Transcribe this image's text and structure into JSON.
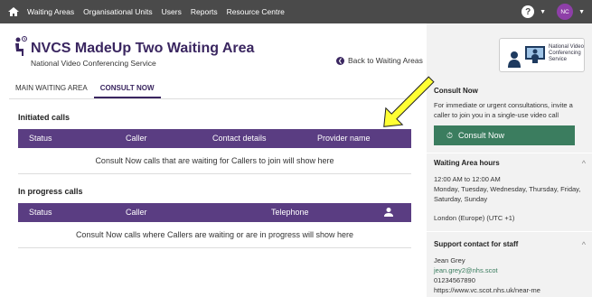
{
  "nav": {
    "items": [
      "Waiting Areas",
      "Organisational Units",
      "Users",
      "Reports",
      "Resource Centre"
    ],
    "avatar": "NC",
    "help": "?"
  },
  "header": {
    "title": "NVCS MadeUp Two Waiting Area",
    "subtitle": "National Video Conferencing Service",
    "back": "Back to Waiting Areas"
  },
  "tabs": [
    {
      "label": "MAIN WAITING AREA",
      "active": false
    },
    {
      "label": "CONSULT NOW",
      "active": true
    }
  ],
  "initiated": {
    "title": "Initiated calls",
    "columns": [
      "Status",
      "Caller",
      "Contact details",
      "Provider name"
    ],
    "empty": "Consult Now calls that are waiting for Callers to join will show here"
  },
  "inprogress": {
    "title": "In progress calls",
    "columns": [
      "Status",
      "Caller",
      "Telephone"
    ],
    "empty": "Consult Now calls where Callers are waiting or are in progress will show here"
  },
  "panel": {
    "logo_text": "National Video Conferencing Service",
    "consult_title": "Consult Now",
    "consult_desc": "For immediate or urgent consultations, invite a caller to join you in a single-use video call",
    "consult_button": "Consult Now",
    "hours_title": "Waiting Area hours",
    "hours_time": "12:00 AM to 12:00 AM",
    "hours_days": "Monday, Tuesday, Wednesday, Thursday, Friday, Saturday, Sunday",
    "timezone": "London (Europe) (UTC +1)",
    "support_title": "Support contact for staff",
    "support_name": "Jean Grey",
    "support_email": "jean.grey2@nhs.scot",
    "support_phone": "01234567890",
    "support_url": "https://www.vc.scot.nhs.uk/near-me"
  },
  "colors": {
    "accent": "#5a3d82",
    "button": "#3b7d5f",
    "topbar": "#4a4a4a",
    "highlight": "#ffff33"
  }
}
